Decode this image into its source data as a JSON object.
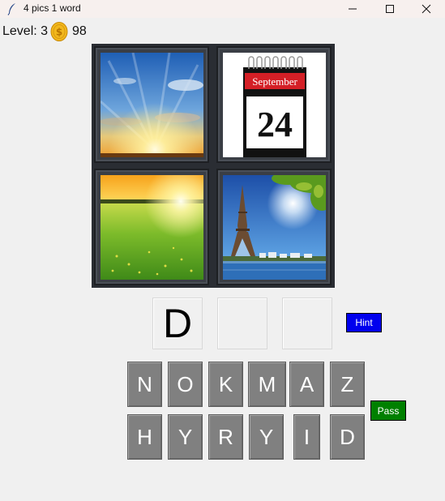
{
  "window": {
    "title": "4 pics 1 word",
    "app_icon": "feather-icon",
    "controls": [
      "minimize-icon",
      "maximize-icon",
      "close-icon"
    ]
  },
  "status": {
    "level_text": "Level: 3",
    "coin_icon": "coin-icon",
    "coins": "98"
  },
  "pictures": [
    {
      "name": "sunrise-sky-picture"
    },
    {
      "name": "calendar-picture",
      "month": "September",
      "day": "24"
    },
    {
      "name": "sunny-meadow-picture"
    },
    {
      "name": "eiffel-tower-picture"
    }
  ],
  "answer": {
    "letters": [
      "D",
      "",
      ""
    ]
  },
  "buttons": {
    "hint": "Hint",
    "pass": "Pass",
    "hint_color": "#0000ee",
    "pass_color": "#008000"
  },
  "keyboard": {
    "row1": [
      "N",
      "O",
      "K",
      "M",
      "A",
      "Z"
    ],
    "row2": [
      "H",
      "Y",
      "R",
      "Y",
      "I",
      "D"
    ],
    "key_color": "#808080"
  }
}
